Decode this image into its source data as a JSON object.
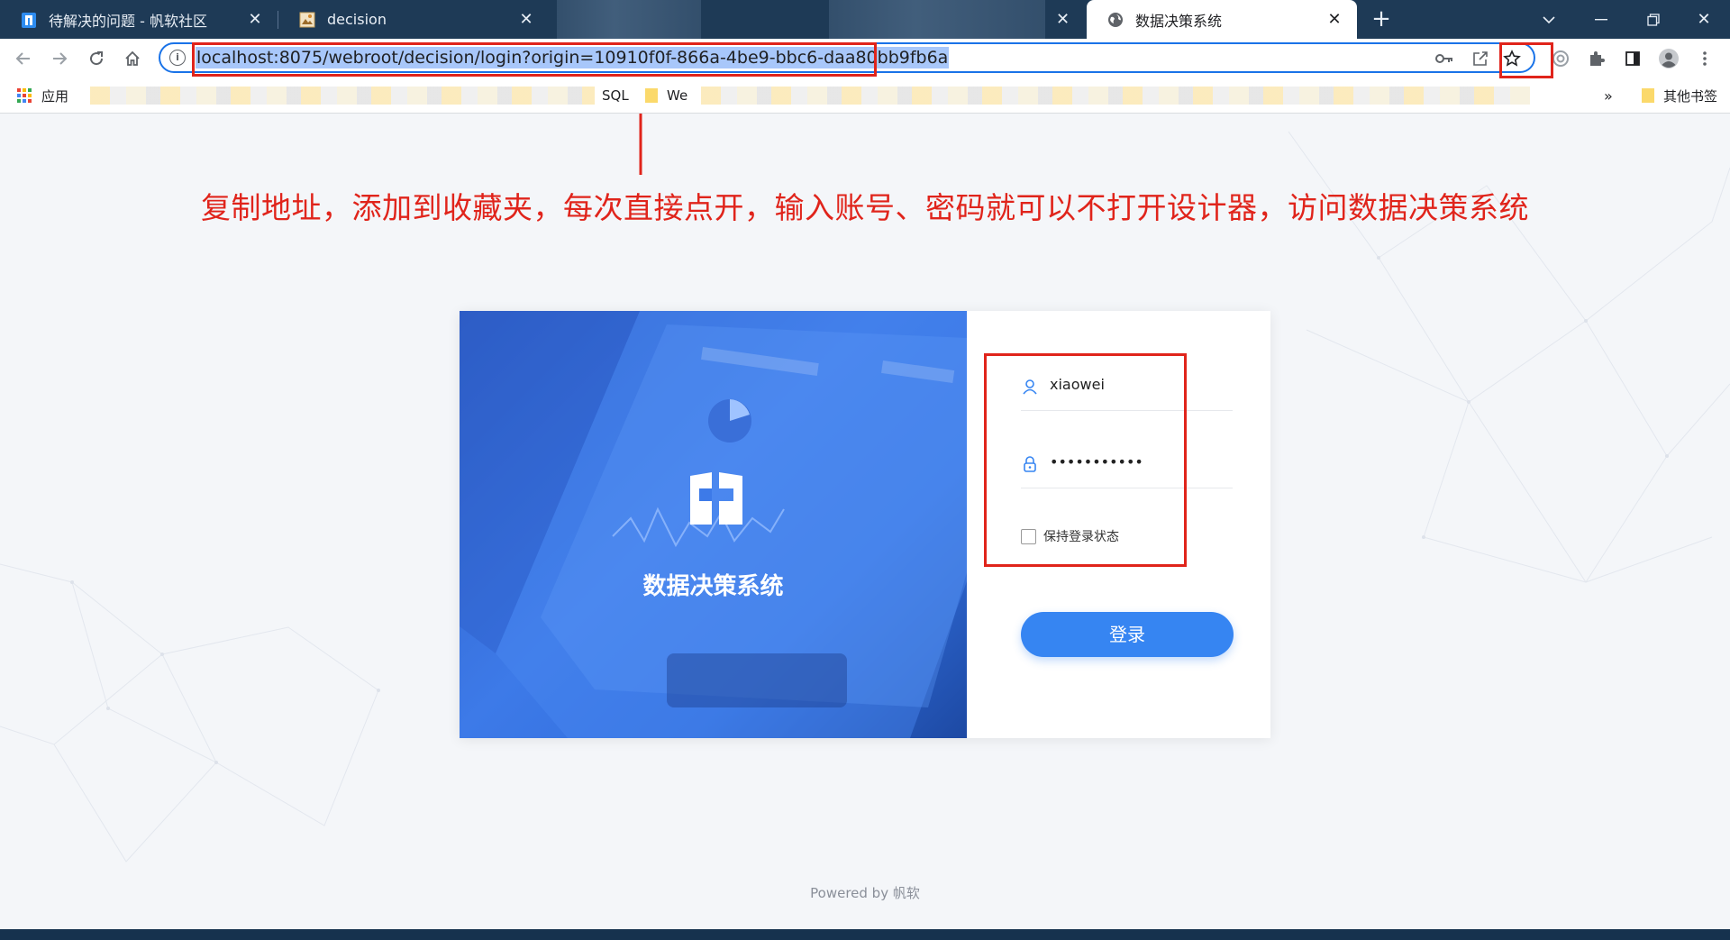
{
  "browser": {
    "tabs": [
      {
        "title": "待解决的问题 - 帆软社区",
        "favicon": "fanruan-logo-icon"
      },
      {
        "title": "decision",
        "favicon": "image-icon"
      },
      {
        "title": "数据决策系统",
        "favicon": "globe-icon",
        "active": true
      }
    ],
    "address": "localhost:8075/webroot/decision/login?origin=10910f0f-866a-4be9-bbc6-daa80bb9fb6a",
    "bookmarks": {
      "apps_label": "应用",
      "sql_label": "SQL",
      "we_label": "We",
      "more": "»",
      "other_label": "其他书签"
    }
  },
  "annotation": "复制地址，添加到收藏夹，每次直接点开，输入账号、密码就可以不打开设计器，访问数据决策系统",
  "login": {
    "brand_title": "数据决策系统",
    "username": "xiaowei",
    "password_mask": "•••••••••••",
    "remember_label": "保持登录状态",
    "login_button": "登录"
  },
  "footer": "Powered by 帆软",
  "colors": {
    "accent": "#3685f2",
    "annotation_red": "#e0241b",
    "tabstrip": "#1e3a56"
  }
}
